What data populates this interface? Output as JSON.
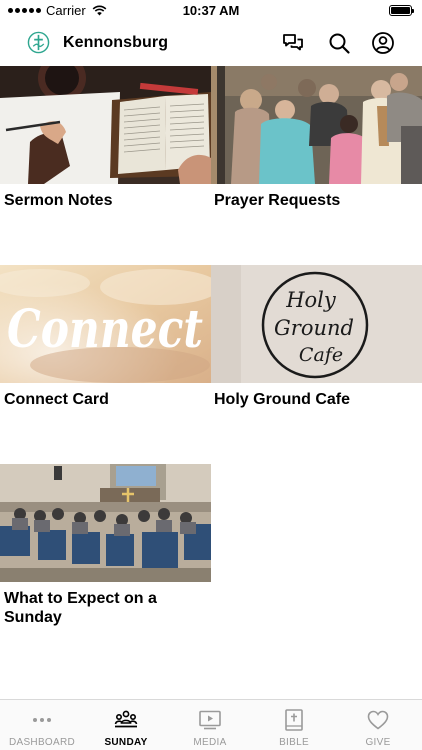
{
  "status_bar": {
    "carrier": "Carrier",
    "time": "10:37 AM",
    "battery_level": 1.0
  },
  "header": {
    "title": "Kennonsburg",
    "logo_icon": "church-logo-icon",
    "accent_color": "#2ea68f",
    "actions": [
      {
        "icon": "chat-icon"
      },
      {
        "icon": "search-icon"
      },
      {
        "icon": "profile-icon"
      }
    ]
  },
  "tiles": [
    {
      "title": "Sermon Notes"
    },
    {
      "title": "Prayer Requests"
    },
    {
      "title": "Connect Card",
      "image_text": "Connect"
    },
    {
      "title": "Holy Ground Cafe",
      "image_text_lines": [
        "Holy",
        "Ground",
        "Cafe"
      ]
    },
    {
      "title": "What to Expect on a Sunday"
    }
  ],
  "tab_bar": {
    "active": "SUNDAY",
    "active_color": "#000000",
    "inactive_color": "#9a9a9a",
    "items": [
      {
        "label": "DASHBOARD",
        "icon": "more-dots-icon"
      },
      {
        "label": "SUNDAY",
        "icon": "people-group-icon"
      },
      {
        "label": "MEDIA",
        "icon": "play-screen-icon"
      },
      {
        "label": "BIBLE",
        "icon": "bible-book-icon"
      },
      {
        "label": "GIVE",
        "icon": "heart-icon"
      }
    ]
  }
}
